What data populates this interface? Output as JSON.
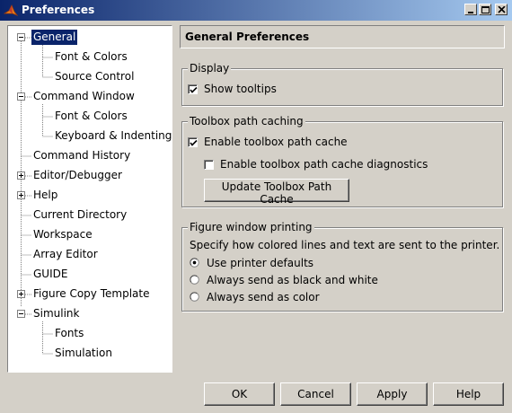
{
  "window": {
    "title": "Preferences"
  },
  "tree": {
    "items": [
      {
        "label": "General",
        "level": 0,
        "expander": "minus",
        "selected": true
      },
      {
        "label": "Font & Colors",
        "level": 1
      },
      {
        "label": "Source Control",
        "level": 1
      },
      {
        "label": "Command Window",
        "level": 0,
        "expander": "minus"
      },
      {
        "label": "Font & Colors",
        "level": 1
      },
      {
        "label": "Keyboard & Indenting",
        "level": 1
      },
      {
        "label": "Command History",
        "level": 0
      },
      {
        "label": "Editor/Debugger",
        "level": 0,
        "expander": "plus"
      },
      {
        "label": "Help",
        "level": 0,
        "expander": "plus"
      },
      {
        "label": "Current Directory",
        "level": 0
      },
      {
        "label": "Workspace",
        "level": 0
      },
      {
        "label": "Array Editor",
        "level": 0
      },
      {
        "label": "GUIDE",
        "level": 0
      },
      {
        "label": "Figure Copy Template",
        "level": 0,
        "expander": "plus"
      },
      {
        "label": "Simulink",
        "level": 0,
        "expander": "minus"
      },
      {
        "label": "Fonts",
        "level": 1
      },
      {
        "label": "Simulation",
        "level": 1
      }
    ]
  },
  "main": {
    "header": "General Preferences",
    "display": {
      "title": "Display",
      "show_tooltips": {
        "label": "Show tooltips",
        "checked": true
      }
    },
    "toolbox": {
      "title": "Toolbox path caching",
      "enable_cache": {
        "label": "Enable toolbox path cache",
        "checked": true
      },
      "enable_diagnostics": {
        "label": "Enable toolbox path cache diagnostics",
        "checked": false
      },
      "update_button": "Update Toolbox Path Cache"
    },
    "printing": {
      "title": "Figure window printing",
      "description": "Specify how colored lines and text are sent to the printer.",
      "options": [
        {
          "label": "Use printer defaults",
          "selected": true
        },
        {
          "label": "Always send as black and white",
          "selected": false
        },
        {
          "label": "Always send as color",
          "selected": false
        }
      ]
    }
  },
  "buttons": {
    "ok": "OK",
    "cancel": "Cancel",
    "apply": "Apply",
    "help": "Help"
  }
}
